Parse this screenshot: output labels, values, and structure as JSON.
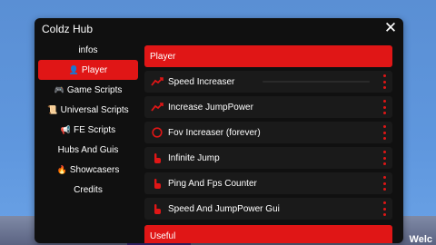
{
  "window": {
    "title": "Coldz Hub",
    "close_glyph": "✕"
  },
  "sidebar": {
    "items": [
      {
        "label": "infos",
        "icon": ""
      },
      {
        "label": "Player",
        "icon": "👤"
      },
      {
        "label": "Game Scripts",
        "icon": "🎮"
      },
      {
        "label": "Universal Scripts",
        "icon": "📜"
      },
      {
        "label": "FE Scripts",
        "icon": "📢"
      },
      {
        "label": "Hubs And Guis",
        "icon": ""
      },
      {
        "label": "Showcasers",
        "icon": "🔥"
      },
      {
        "label": "Credits",
        "icon": ""
      }
    ]
  },
  "main": {
    "section_title": "Player",
    "items": [
      {
        "label": "Speed Increaser",
        "icon": "trend-up-icon"
      },
      {
        "label": "Increase JumpPower",
        "icon": "trend-up-icon"
      },
      {
        "label": "Fov Increaser (forever)",
        "icon": "circle-icon"
      },
      {
        "label": "Infinite Jump",
        "icon": "tap-hand-icon"
      },
      {
        "label": "Ping And Fps Counter",
        "icon": "tap-hand-icon"
      },
      {
        "label": "Speed And JumpPower Gui",
        "icon": "tap-hand-icon"
      }
    ],
    "next_section_title": "Useful"
  },
  "background": {
    "partial_text": "Welc"
  },
  "colors": {
    "accent": "#e01616",
    "panel": "#101010",
    "row": "#1a1a1a"
  }
}
